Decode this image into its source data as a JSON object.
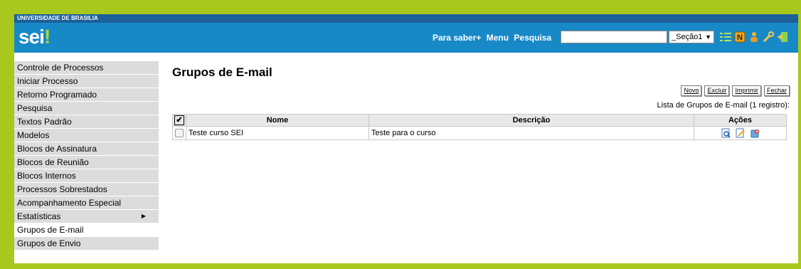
{
  "top_bar": {
    "org": "UNIVERSIDADE DE BRASILIA"
  },
  "header": {
    "logo_main": "sei",
    "logo_dot": "!",
    "nav": {
      "saber_label": "Para saber+",
      "menu_label": "Menu",
      "pesquisa_label": "Pesquisa"
    },
    "search": {
      "value": ""
    },
    "unit_select": {
      "value": "_Seção1"
    },
    "icons": [
      "grid-icon",
      "notification-n-icon",
      "user-icon",
      "tools-icon",
      "exit-icon"
    ]
  },
  "sidebar": {
    "items": [
      {
        "label": "Controle de Processos"
      },
      {
        "label": "Iniciar Processo"
      },
      {
        "label": "Retorno Programado"
      },
      {
        "label": "Pesquisa"
      },
      {
        "label": "Textos Padrão"
      },
      {
        "label": "Modelos"
      },
      {
        "label": "Blocos de Assinatura"
      },
      {
        "label": "Blocos de Reunião"
      },
      {
        "label": "Blocos Internos"
      },
      {
        "label": "Processos Sobrestados"
      },
      {
        "label": "Acompanhamento Especial"
      },
      {
        "label": "Estatísticas"
      },
      {
        "label": "Grupos de E-mail"
      },
      {
        "label": "Grupos de Envio"
      }
    ]
  },
  "main": {
    "title": "Grupos de E-mail",
    "buttons": {
      "novo": "Novo",
      "excluir": "Excluir",
      "imprimir": "Imprimir",
      "fechar": "Fechar"
    },
    "caption": "Lista de Grupos de E-mail (1 registro):",
    "table": {
      "headers": {
        "nome": "Nome",
        "descricao": "Descrição",
        "acoes": "Ações"
      },
      "rows": [
        {
          "nome": "Teste curso SEI",
          "descricao": "Teste para o curso"
        }
      ]
    }
  },
  "colors": {
    "accent_frame": "#a8c81e",
    "header_blue": "#1889c7",
    "top_blue": "#1c5f9b"
  }
}
